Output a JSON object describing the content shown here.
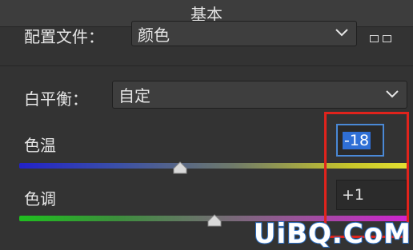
{
  "panel": {
    "title": "基本"
  },
  "profile": {
    "label": "配置文件：",
    "value": "颜色"
  },
  "white_balance": {
    "label": "白平衡：",
    "value": "自定"
  },
  "temperature": {
    "label": "色温",
    "value": "-18",
    "slider_value": -18
  },
  "tint": {
    "label": "色调",
    "value": "+1",
    "slider_value": 1
  },
  "watermark": {
    "text": "UiBQ.CoM"
  },
  "colors": {
    "highlight_box": "#e0231c",
    "focus_border": "#4a89d6",
    "selection": "#2f6fd6"
  }
}
